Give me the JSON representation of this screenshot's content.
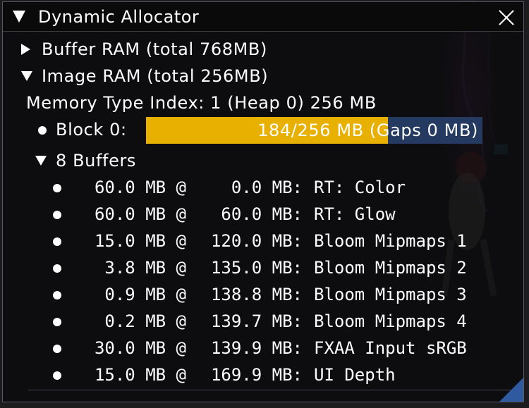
{
  "window": {
    "title": "Dynamic Allocator",
    "close_icon": "close-icon",
    "collapse_icon": "collapse-arrow-icon"
  },
  "tree": {
    "buffer_ram": "Buffer RAM (total 768MB)",
    "image_ram": "Image RAM (total 256MB)",
    "memory_type": "Memory Type Index: 1 (Heap 0) 256 MB",
    "block_label": "Block 0:",
    "block_progress_text": "184/256 MB (Gaps 0 MB)",
    "block_used_fraction": 0.71875,
    "buffers_label": "8 Buffers"
  },
  "buffers": [
    {
      "size": "60.0 MB @",
      "offset": "0.0 MB:",
      "name": "RT: Color"
    },
    {
      "size": "60.0 MB @",
      "offset": "60.0 MB:",
      "name": "RT: Glow"
    },
    {
      "size": "15.0 MB @",
      "offset": "120.0 MB:",
      "name": "Bloom Mipmaps 1"
    },
    {
      "size": "3.8 MB @",
      "offset": "135.0 MB:",
      "name": "Bloom Mipmaps 2"
    },
    {
      "size": "0.9 MB @",
      "offset": "138.8 MB:",
      "name": "Bloom Mipmaps 3"
    },
    {
      "size": "0.2 MB @",
      "offset": "139.7 MB:",
      "name": "Bloom Mipmaps 4"
    },
    {
      "size": "30.0 MB @",
      "offset": "139.9 MB:",
      "name": "FXAA Input sRGB"
    },
    {
      "size": "15.0 MB @",
      "offset": "169.9 MB:",
      "name": "UI Depth"
    }
  ],
  "colors": {
    "progress_fill": "#e8b000",
    "progress_track": "#243a60",
    "resize_grip": "#2f5aa0"
  }
}
